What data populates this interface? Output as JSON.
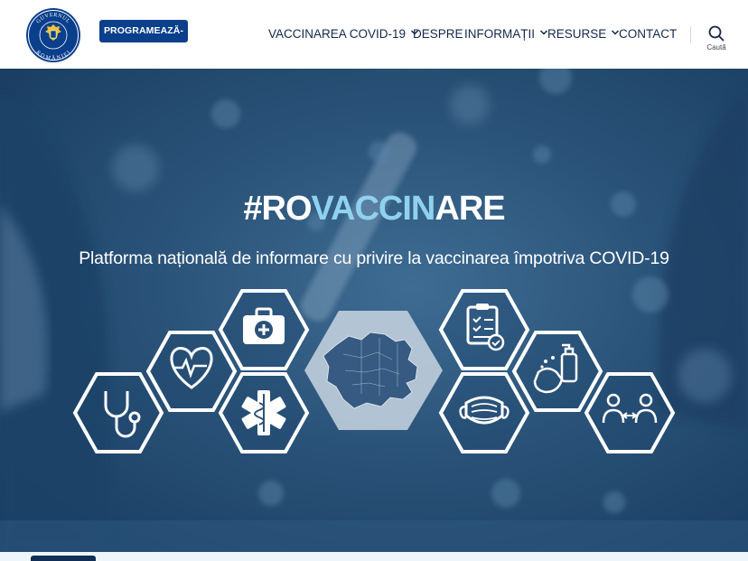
{
  "header": {
    "logo_text": [
      "GUVERNUL",
      "ROMÂNIEI"
    ],
    "cta_label": "PROGRAMEAZĂ-TE",
    "nav": [
      {
        "label": "VACCINAREA COVID-19",
        "has_dropdown": true
      },
      {
        "label": "DESPRE",
        "has_dropdown": false
      },
      {
        "label": "INFORMAȚII",
        "has_dropdown": true
      },
      {
        "label": "RESURSE",
        "has_dropdown": true
      },
      {
        "label": "CONTACT",
        "has_dropdown": false
      }
    ],
    "search_label": "Caută"
  },
  "hero": {
    "title_parts": [
      "#RO",
      "VACCIN",
      "ARE"
    ],
    "subtitle": "Platforma națională de informare cu privire la vaccinarea împotriva COVID-19",
    "icons": [
      "stethoscope-icon",
      "heartbeat-icon",
      "first-aid-kit-icon",
      "medical-star-icon",
      "romania-map-icon",
      "checklist-icon",
      "face-mask-icon",
      "hand-sanitizer-icon",
      "social-distancing-icon"
    ]
  },
  "colors": {
    "brand": "#0a3f8c",
    "nav_text": "#13284a",
    "accent": "#8fd1ee"
  }
}
